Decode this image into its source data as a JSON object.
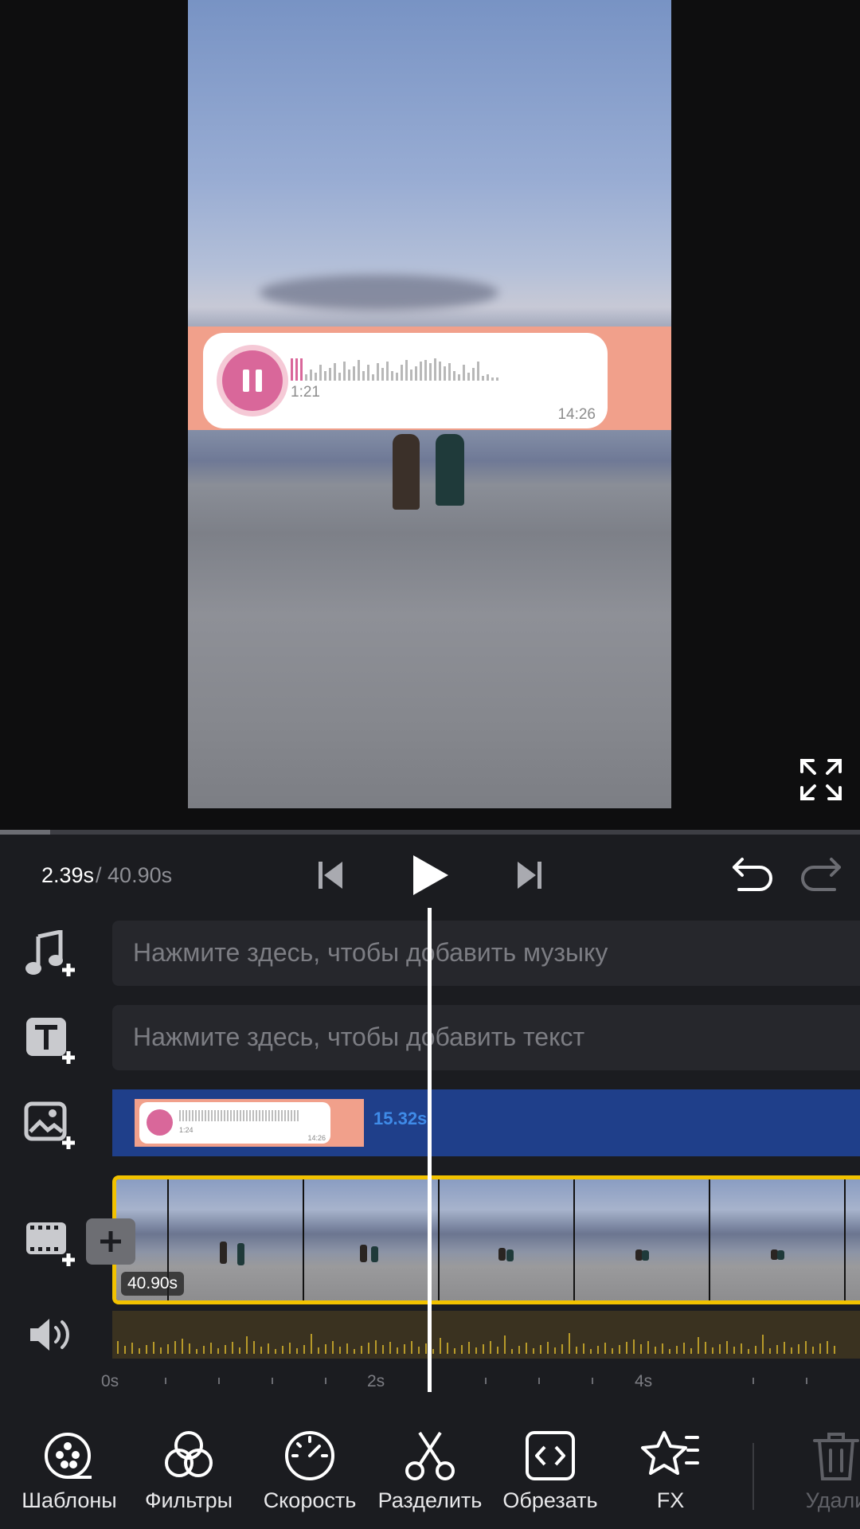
{
  "preview": {
    "voice_message": {
      "duration": "1:21",
      "sent_time": "14:26"
    },
    "fullscreen_icon": "fullscreen-icon"
  },
  "playback": {
    "current_time": "2.39s",
    "separator": "/",
    "total_time": "40.90s",
    "progress_fraction": 0.058
  },
  "tracks": {
    "music": {
      "placeholder": "Нажмите здесь, чтобы добавить музыку",
      "icon": "music-add-icon"
    },
    "text": {
      "placeholder": "Нажмите здесь, чтобы добавить текст",
      "icon": "text-add-icon"
    },
    "overlay": {
      "duration_label": "15.32s",
      "thumb_duration": "1:24",
      "thumb_time": "14:26",
      "icon": "overlay-add-icon"
    },
    "video": {
      "duration_badge": "40.90s",
      "icon": "video-add-icon"
    },
    "audio": {
      "icon": "volume-icon"
    }
  },
  "ruler": {
    "labels": [
      "0s",
      "2s",
      "4s"
    ]
  },
  "toolbar": {
    "items": [
      {
        "label": "Шаблоны",
        "icon": "templates-icon"
      },
      {
        "label": "Фильтры",
        "icon": "filters-icon"
      },
      {
        "label": "Скорость",
        "icon": "speed-icon"
      },
      {
        "label": "Разделить",
        "icon": "scissors-icon"
      },
      {
        "label": "Обрезать",
        "icon": "trim-icon"
      },
      {
        "label": "FX",
        "icon": "fx-star-icon"
      },
      {
        "label": "Удали",
        "icon": "trash-icon"
      }
    ]
  },
  "colors": {
    "accent_yellow": "#f2c200",
    "overlay_blue": "#1f3f8a",
    "overlay_label": "#3f8be8",
    "bubble_pink": "#d9679a",
    "sticker_bg": "#f1a08b"
  }
}
